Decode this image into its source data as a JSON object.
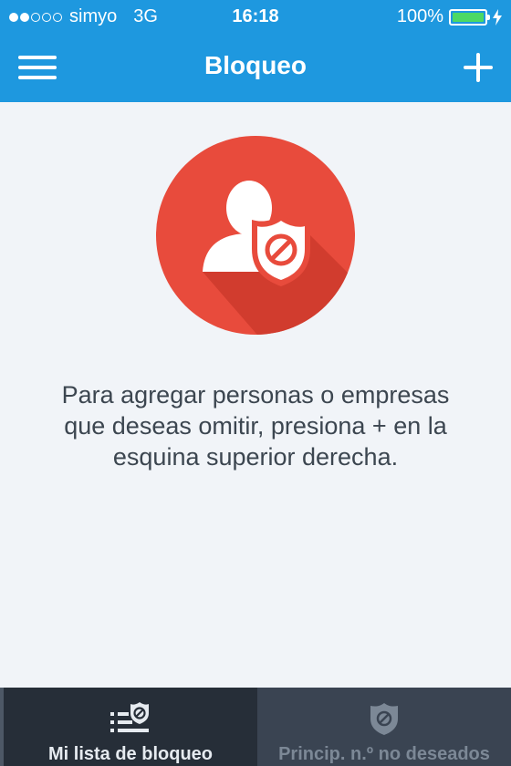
{
  "status_bar": {
    "carrier": "simyo",
    "network": "3G",
    "time": "16:18",
    "battery_percent": "100%",
    "signal_dots_filled": 2,
    "signal_dots_total": 5
  },
  "navbar": {
    "title": "Bloqueo",
    "menu_icon": "hamburger-menu-icon",
    "add_icon": "plus-icon"
  },
  "empty_state": {
    "icon": "person-shield-block-icon",
    "message_lines": [
      "Para agregar personas o empresas",
      "que deseas omitir, presiona + en la",
      "esquina superior derecha."
    ]
  },
  "tabs": [
    {
      "label": "Mi lista de bloqueo",
      "icon": "block-list-icon",
      "active": true
    },
    {
      "label": "Princip. n.º no deseados",
      "icon": "shield-block-icon",
      "active": false
    }
  ],
  "colors": {
    "header": "#1e98df",
    "background": "#f1f4f8",
    "badge": "#e84b3c",
    "tab_active": "#262e38",
    "tab_inactive": "#3a4452",
    "battery": "#4cd964"
  }
}
